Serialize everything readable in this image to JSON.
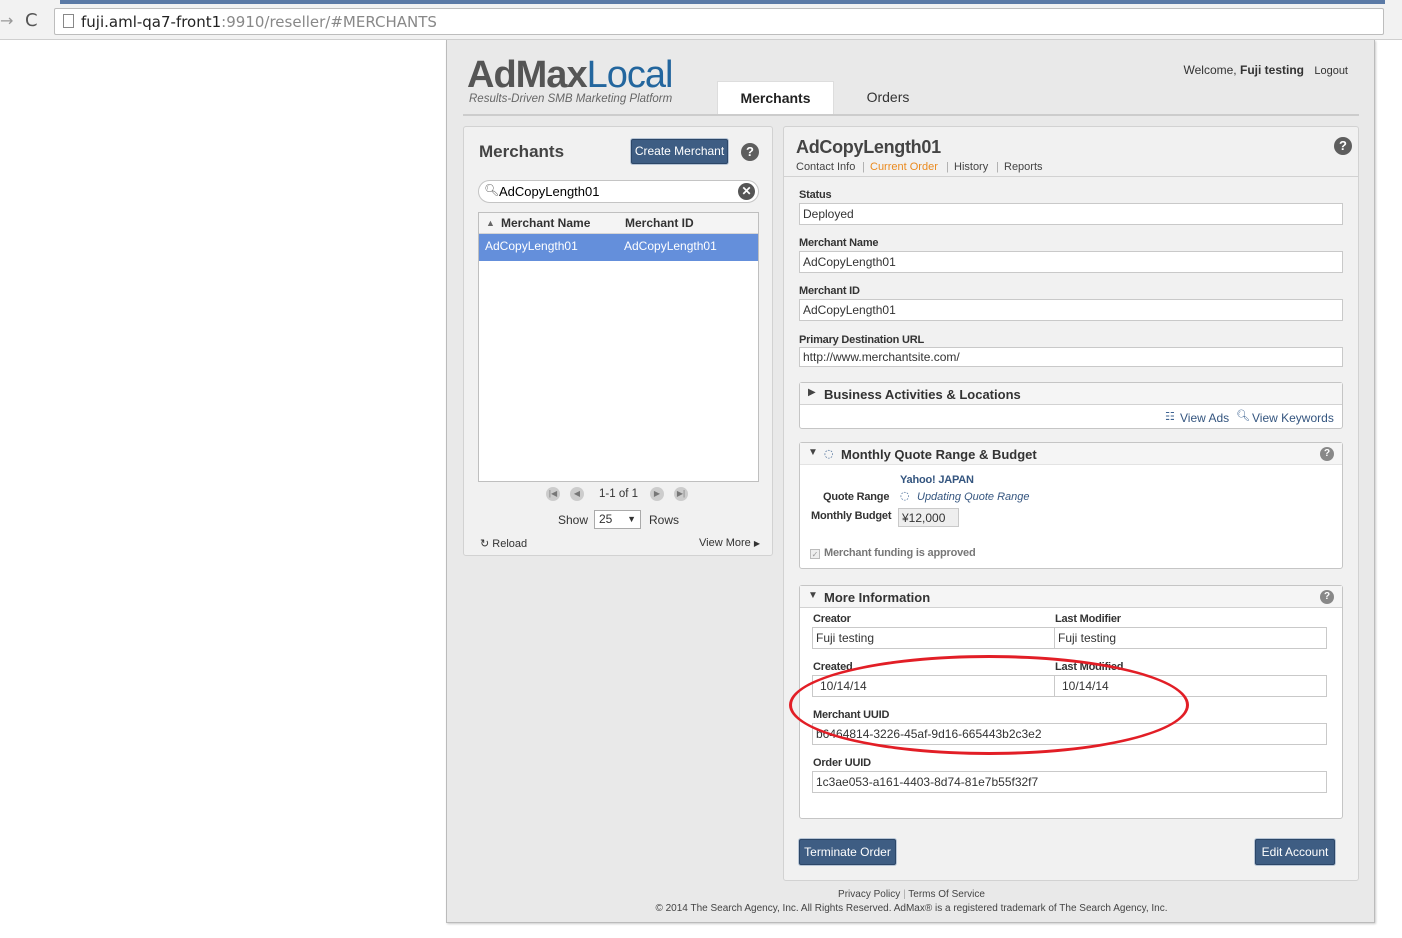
{
  "browser": {
    "url_host": "fuji.aml-qa7-front1",
    "url_rest": ":9910/reseller/#MERCHANTS",
    "back_icon": "→",
    "reload_icon": "C"
  },
  "header": {
    "logo_part1": "AdMax",
    "logo_part2": "Local",
    "tagline": "Results-Driven SMB Marketing Platform",
    "welcome_prefix": "Welcome,",
    "user_name": "Fuji testing",
    "logout": "Logout",
    "tabs": [
      {
        "label": "Merchants",
        "active": true
      },
      {
        "label": "Orders",
        "active": false
      }
    ]
  },
  "left_panel": {
    "title": "Merchants",
    "create_button": "Create Merchant",
    "help": "?",
    "search_value": "AdCopyLength01",
    "clear_icon": "✕",
    "columns": [
      "Merchant Name",
      "Merchant ID"
    ],
    "rows": [
      {
        "name": "AdCopyLength01",
        "id": "AdCopyLength01"
      }
    ],
    "pager_text": "1-1 of 1",
    "show_label": "Show",
    "rows_per_page": "25",
    "rows_label": "Rows",
    "reload": "Reload",
    "view_more": "View More"
  },
  "right_panel": {
    "title": "AdCopyLength01",
    "help": "?",
    "subnav": [
      "Contact Info",
      "Current Order",
      "History",
      "Reports"
    ],
    "subnav_active": "Current Order",
    "status_label": "Status",
    "status_value": "Deployed",
    "merchant_name_label": "Merchant Name",
    "merchant_name_value": "AdCopyLength01",
    "merchant_id_label": "Merchant ID",
    "merchant_id_value": "AdCopyLength01",
    "url_label": "Primary Destination URL",
    "url_value": "http://www.merchantsite.com/",
    "business_section": {
      "title": "Business Activities & Locations",
      "view_ads": "View Ads",
      "view_keywords": "View Keywords"
    },
    "quote_section": {
      "title": "Monthly Quote Range & Budget",
      "provider": "Yahoo! JAPAN",
      "quote_range_label": "Quote Range",
      "quote_range_value": "Updating Quote Range",
      "monthly_budget_label": "Monthly Budget",
      "monthly_budget_value": "¥12,000",
      "funding_label": "Merchant funding is approved",
      "help": "?"
    },
    "more_info": {
      "title": "More Information",
      "help": "?",
      "creator_label": "Creator",
      "creator_value": "Fuji testing",
      "last_modifier_label": "Last Modifier",
      "last_modifier_value": "Fuji testing",
      "created_label": "Created",
      "created_value": "10/14/14",
      "last_modified_label": "Last Modified",
      "last_modified_value": "10/14/14",
      "merchant_uuid_label": "Merchant UUID",
      "merchant_uuid_value": "b6464814-3226-45af-9d16-665443b2c3e2",
      "order_uuid_label": "Order UUID",
      "order_uuid_value": "1c3ae053-a161-4403-8d74-81e7b55f32f7"
    },
    "terminate_button": "Terminate Order",
    "edit_button": "Edit Account"
  },
  "footer": {
    "privacy": "Privacy Policy",
    "terms": "Terms Of Service",
    "copyright": "© 2014 The Search Agency, Inc. All Rights Reserved. AdMax® is a registered trademark of The Search Agency, Inc."
  },
  "colors": {
    "accent": "#3e5d83",
    "selected_row": "#648fdb",
    "active_subnav": "#ea8a1f",
    "annotation": "#e21e26",
    "logo_blue": "#23669e"
  }
}
